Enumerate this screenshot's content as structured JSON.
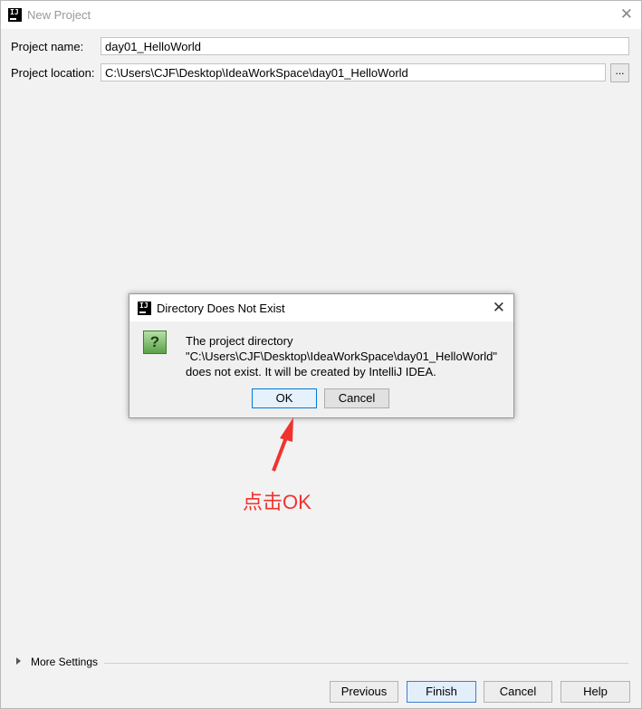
{
  "window": {
    "title": "New Project",
    "close_icon": "close-icon"
  },
  "form": {
    "project_name_label": "Project name:",
    "project_name_value": "day01_HelloWorld",
    "project_location_label": "Project location:",
    "project_location_value": "C:\\Users\\CJF\\Desktop\\IdeaWorkSpace\\day01_HelloWorld",
    "browse_label": "..."
  },
  "dialog": {
    "title": "Directory Does Not Exist",
    "icon": "question-icon",
    "message_line1": "The project directory",
    "message_line2": "\"C:\\Users\\CJF\\Desktop\\IdeaWorkSpace\\day01_HelloWorld\"",
    "message_line3": "does not exist. It will be created by IntelliJ IDEA.",
    "ok_label": "OK",
    "cancel_label": "Cancel"
  },
  "annotation": {
    "text": "点击OK",
    "color": "#f0332e"
  },
  "more_settings": {
    "label": "More Settings"
  },
  "footer": {
    "previous_label": "Previous",
    "finish_label": "Finish",
    "cancel_label": "Cancel",
    "help_label": "Help"
  },
  "colors": {
    "window_bg": "#f2f2f2",
    "primary_border": "#0078d7"
  }
}
